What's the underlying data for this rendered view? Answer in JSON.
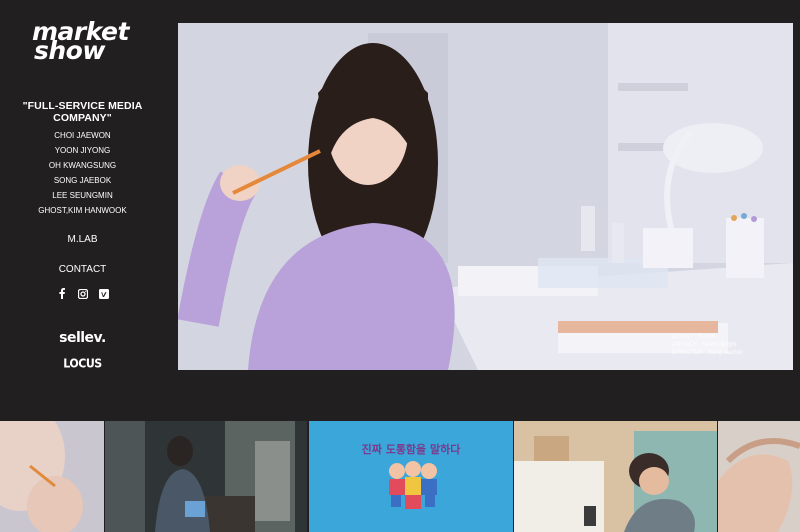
{
  "logo": {
    "line1": "market",
    "line2": "show"
  },
  "tagline": "\"FULL-SERVICE MEDIA COMPANY\"",
  "directors": [
    "CHOI JAEWON",
    "YOON JIYONG",
    "OH KWANGSUNG",
    "SONG JAEBOK",
    "LEE SEUNGMIN",
    "GHOST,KIM HANWOOK"
  ],
  "nav": {
    "mlab": "M.LAB",
    "contact": "CONTACT"
  },
  "social": [
    "facebook-icon",
    "instagram-icon",
    "vimeo-icon"
  ],
  "brands": {
    "sellev": "sellev.",
    "locus": "LOCUS"
  },
  "hero": {
    "credit_client": "CLIENT : YOON",
    "credit_agency": "AGENCY : Studio Bright",
    "credit_director": "DIRECTOR : Song Jaebok"
  },
  "thumbnails": [
    {
      "label": ""
    },
    {
      "label": ""
    },
    {
      "label": "진짜 도통함을 말하다"
    },
    {
      "label": ""
    },
    {
      "label": ""
    }
  ],
  "colors": {
    "background": "#221f20",
    "thumb_blue": "#3aa6d9"
  }
}
